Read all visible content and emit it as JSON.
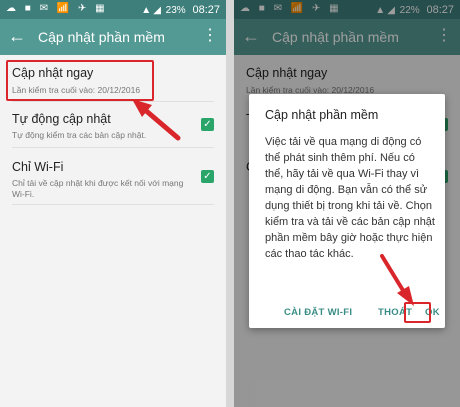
{
  "left_screen": {
    "status": {
      "icons": "☁ ■ ✉ 📶 ✈ ▦",
      "battery": "23%",
      "time": "08:27"
    },
    "appbar": {
      "back_glyph": "←",
      "title": "Cập nhật phần mềm",
      "more_glyph": "⋮"
    },
    "prefs": [
      {
        "title": "Cập nhật ngay",
        "summary": "Lần kiểm tra cuối vào: 20/12/2016",
        "checked": false
      },
      {
        "title": "Tự động cập nhật",
        "summary": "Tự động kiểm tra các bản cập nhật.",
        "checked": true,
        "check_glyph": "✓"
      },
      {
        "title": "Chỉ Wi-Fi",
        "summary": "Chỉ tải về cập nhật khi được kết nối với mạng",
        "summary2": "Wi-Fi.",
        "checked": true,
        "check_glyph": "✓"
      }
    ]
  },
  "right_screen": {
    "status": {
      "icons": "☁ ■ ✉ 📶 ✈ ▦",
      "battery": "22%",
      "time": "08:27"
    },
    "appbar": {
      "back_glyph": "←",
      "title": "Cập nhật phần mềm",
      "more_glyph": "⋮"
    },
    "bg_prefs": [
      {
        "title": "Cập nhật ngay",
        "summary": "Lần kiểm tra cuối vào: 20/12/2016"
      },
      {
        "title": "T",
        "summary": ""
      },
      {
        "title": "C",
        "summary": ""
      }
    ],
    "dialog": {
      "title": "Cập nhật phần mềm",
      "message": "Việc tải về qua mạng di động có thể phát sinh thêm phí. Nếu có thể, hãy tải về qua Wi-Fi thay vì mạng di động. Bạn vẫn có thể sử dụng thiết bị trong khi tải về. Chọn kiểm tra và tải về các bản cập nhật phần mềm bây giờ hoặc thực hiện các thao tác khác.",
      "buttons": {
        "wifi_settings": "CÀI ĐẶT WI-FI",
        "exit": "THOÁT",
        "ok": "OK"
      }
    }
  },
  "colors": {
    "statusbar": "#3e7f7b",
    "appbar": "#549a94",
    "checkbox": "#2aa56a",
    "highlight": "#d9262b",
    "dialog_button": "#3a8c86"
  }
}
